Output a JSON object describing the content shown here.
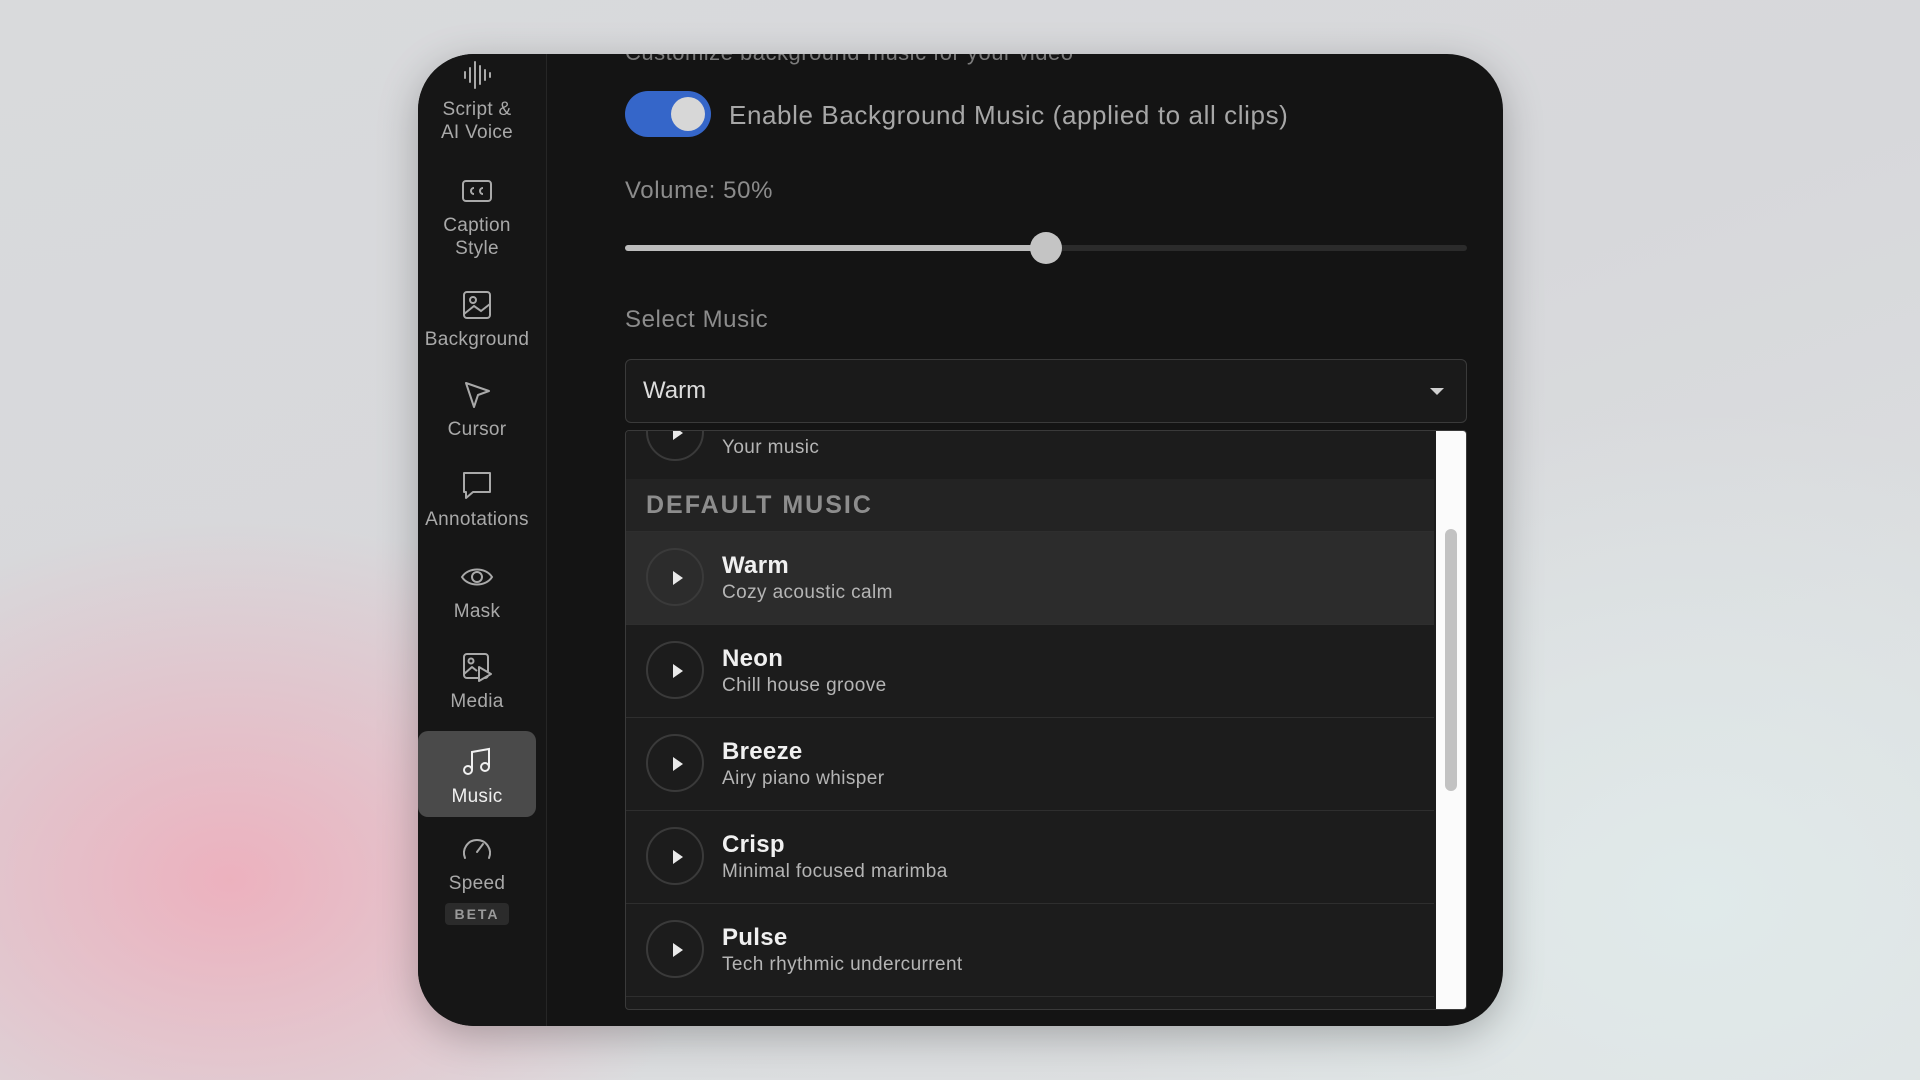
{
  "sidebar": {
    "items": [
      {
        "label": "Script &\nAI Voice",
        "icon": "waveform-icon"
      },
      {
        "label": "Caption\nStyle",
        "icon": "cc-icon"
      },
      {
        "label": "Background",
        "icon": "image-icon"
      },
      {
        "label": "Cursor",
        "icon": "cursor-icon"
      },
      {
        "label": "Annotations",
        "icon": "comment-icon"
      },
      {
        "label": "Mask",
        "icon": "eye-icon"
      },
      {
        "label": "Media",
        "icon": "media-icon"
      },
      {
        "label": "Music",
        "icon": "music-note-icon",
        "active": true
      },
      {
        "label": "Speed",
        "icon": "speedometer-icon",
        "badge": "BETA"
      }
    ]
  },
  "music": {
    "cut_heading": "Customize background music for your video",
    "toggle_label": "Enable Background Music (applied to all clips)",
    "toggle_on": true,
    "volume_label": "Volume: 50%",
    "volume_fraction": 0.5,
    "select_label": "Select Music",
    "selected_value": "Warm",
    "dropdown": {
      "top_item_subtitle": "Your music",
      "section_header": "DEFAULT MUSIC",
      "items": [
        {
          "title": "Warm",
          "subtitle": "Cozy acoustic calm",
          "selected": true
        },
        {
          "title": "Neon",
          "subtitle": "Chill house groove"
        },
        {
          "title": "Breeze",
          "subtitle": "Airy piano whisper"
        },
        {
          "title": "Crisp",
          "subtitle": "Minimal focused marimba"
        },
        {
          "title": "Pulse",
          "subtitle": "Tech rhythmic undercurrent"
        }
      ]
    }
  },
  "colors": {
    "accent": "#3566c9",
    "panel": "#141414",
    "selected_row": "#2c2c2c"
  }
}
